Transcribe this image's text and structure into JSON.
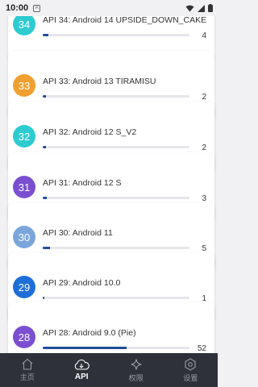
{
  "status_bar": {
    "time": "10:00",
    "notification_glyph": "A"
  },
  "apis": [
    {
      "badge": "34",
      "color": "#2ecbd1",
      "label": "API 34: Android 14 UPSIDE_DOWN_CAKE",
      "count": "4",
      "progress": 0.04
    },
    {
      "badge": "33",
      "color": "#f0a030",
      "label": "API 33: Android 13 TIRAMISU",
      "count": "2",
      "progress": 0.02
    },
    {
      "badge": "32",
      "color": "#2ecbd1",
      "label": "API 32: Android 12 S_V2",
      "count": "2",
      "progress": 0.02
    },
    {
      "badge": "31",
      "color": "#7b4fd0",
      "label": "API 31: Android 12 S",
      "count": "3",
      "progress": 0.03
    },
    {
      "badge": "30",
      "color": "#7aa6dc",
      "label": "API 30: Android 11",
      "count": "5",
      "progress": 0.05
    },
    {
      "badge": "29",
      "color": "#1f6fd8",
      "label": "API 29: Android 10.0",
      "count": "1",
      "progress": 0.01
    },
    {
      "badge": "28",
      "color": "#7b4fd0",
      "label": "API 28: Android 9.0 (Pie)",
      "count": "52",
      "progress": 0.57
    }
  ],
  "nav": [
    {
      "label": "主页",
      "icon": "home-icon",
      "active": false
    },
    {
      "label": "API",
      "icon": "cloud-icon",
      "active": true
    },
    {
      "label": "权限",
      "icon": "sparkle-icon",
      "active": false
    },
    {
      "label": "设置",
      "icon": "gear-icon",
      "active": false
    }
  ]
}
